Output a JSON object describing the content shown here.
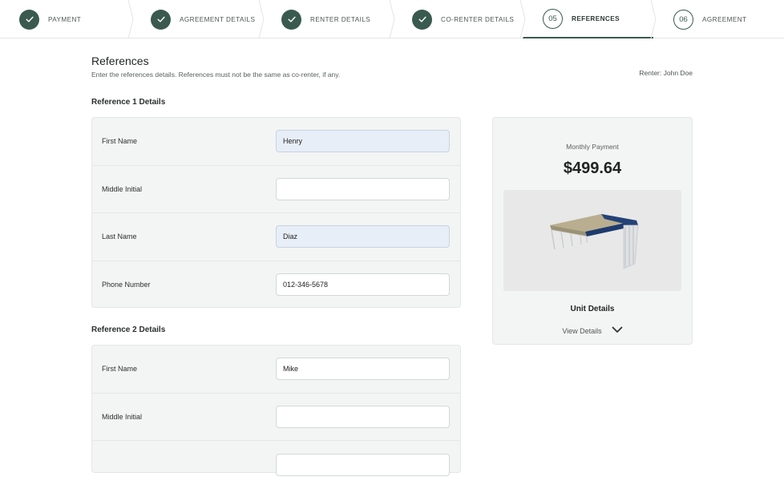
{
  "stepper": {
    "steps": [
      {
        "label": "PAYMENT",
        "state": "done",
        "number": ""
      },
      {
        "label": "AGREEMENT DETAILS",
        "state": "done",
        "number": ""
      },
      {
        "label": "RENTER DETAILS",
        "state": "done",
        "number": ""
      },
      {
        "label": "CO-RENTER DETAILS",
        "state": "done",
        "number": ""
      },
      {
        "label": "REFERENCES",
        "state": "active",
        "number": "05"
      },
      {
        "label": "AGREEMENT",
        "state": "todo",
        "number": "06"
      }
    ]
  },
  "header": {
    "title": "References",
    "subtitle": "Enter the references details. References must not be the same as co-renter, if any.",
    "renter": "Renter: John Doe"
  },
  "reference1": {
    "title": "Reference 1 Details",
    "first_name_label": "First Name",
    "first_name_value": "Henry",
    "middle_initial_label": "Middle Initial",
    "middle_initial_value": "",
    "last_name_label": "Last Name",
    "last_name_value": "Diaz",
    "phone_label": "Phone Number",
    "phone_value": "012-346-5678"
  },
  "reference2": {
    "title": "Reference 2 Details",
    "first_name_label": "First Name",
    "first_name_value": "Mike",
    "middle_initial_label": "Middle Initial",
    "middle_initial_value": ""
  },
  "summary": {
    "monthly_label": "Monthly Payment",
    "monthly_value": "$499.64",
    "unit_title": "Unit Details",
    "view_details": "View Details"
  },
  "colors": {
    "accent": "#3a5a4f",
    "autofill": "#e8eef8",
    "card_bg": "#f3f5f4",
    "roof_blue": "#1f3a6e"
  },
  "icons": {
    "done_step": "check-icon",
    "view_details": "chevron-down-icon"
  }
}
